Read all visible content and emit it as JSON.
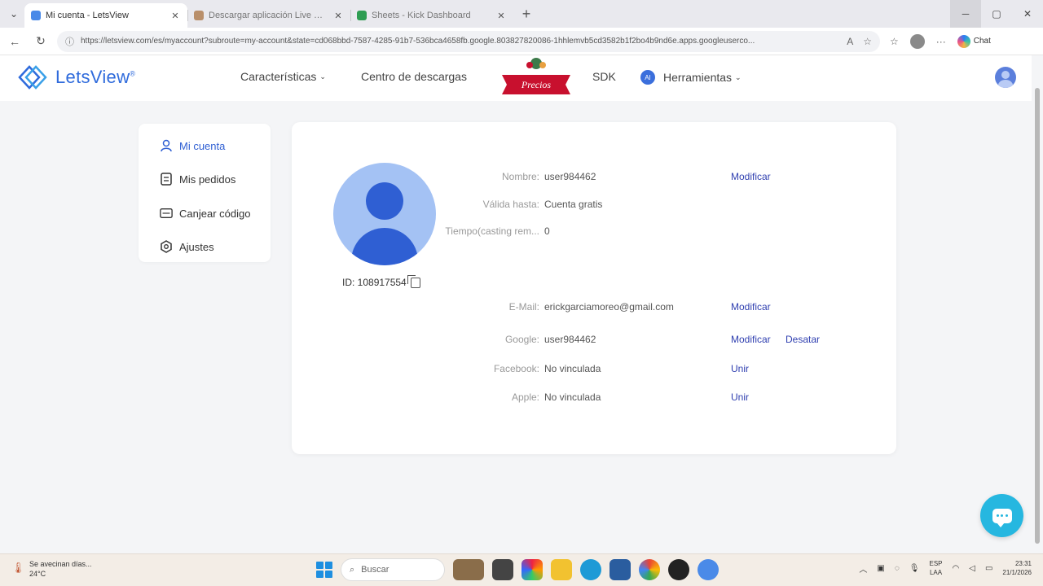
{
  "browser": {
    "tabs": [
      {
        "label": "Mi cuenta - LetsView",
        "active": true,
        "color": "#4a8ae8"
      },
      {
        "label": "Descargar aplicación Live Wor",
        "active": false,
        "color": "#b98f6a"
      },
      {
        "label": "Sheets - Kick Dashboard",
        "active": false,
        "color": "#2e9d52"
      }
    ],
    "tab_close": "✕",
    "new_tab": "+",
    "url": "https://letsview.com/es/myaccount?subroute=my-account&state=cd068bbd-7587-4285-91b7-536bca4658fb.google.803827820086-1hhlemvb5cd3582b1f2bo4b9nd6e.apps.googleuserco...",
    "copilot_label": "Chat"
  },
  "site": {
    "logo_text": "LetsView",
    "logo_reg": "®",
    "nav": {
      "features": "Características",
      "downloads": "Centro de descargas",
      "price_badge": "Precios",
      "sdk": "SDK",
      "ai_badge": "AI",
      "tools": "Herramientas"
    }
  },
  "sidebar": {
    "items": [
      {
        "label": "Mi cuenta",
        "icon": "user-icon",
        "active": true
      },
      {
        "label": "Mis pedidos",
        "icon": "orders-icon",
        "active": false
      },
      {
        "label": "Canjear código",
        "icon": "code-icon",
        "active": false
      },
      {
        "label": "Ajustes",
        "icon": "settings-icon",
        "active": false
      }
    ]
  },
  "account": {
    "user_id": "ID: 108917554",
    "fields": {
      "name_label": "Nombre:",
      "name_value": "user984462",
      "valid_label": "Válida hasta:",
      "valid_value": "Cuenta gratis",
      "time_label": "Tiempo(casting rem...",
      "time_value": "0",
      "email_label": "E-Mail:",
      "email_value": "erickgarciamoreo@gmail.com",
      "google_label": "Google:",
      "google_value": "user984462",
      "facebook_label": "Facebook:",
      "facebook_value": "No vinculada",
      "apple_label": "Apple:",
      "apple_value": "No vinculada"
    },
    "actions": {
      "modify_name": "Modificar",
      "modify_email": "Modificar",
      "modify_google": "Modificar",
      "unlink_google": "Desatar",
      "link_facebook": "Unir",
      "link_apple": "Unir"
    }
  },
  "taskbar": {
    "weather_line1": "Se avecinan días...",
    "weather_line2": "24°C",
    "search_placeholder": "Buscar",
    "lang_line1": "ESP",
    "lang_line2": "LAA",
    "time": "23:31",
    "date": "21/1/2026"
  },
  "colors": {
    "accent": "#2f5fd3",
    "link": "#2f3fb0",
    "chat": "#26b7e0",
    "price_ribbon": "#c8102e"
  }
}
